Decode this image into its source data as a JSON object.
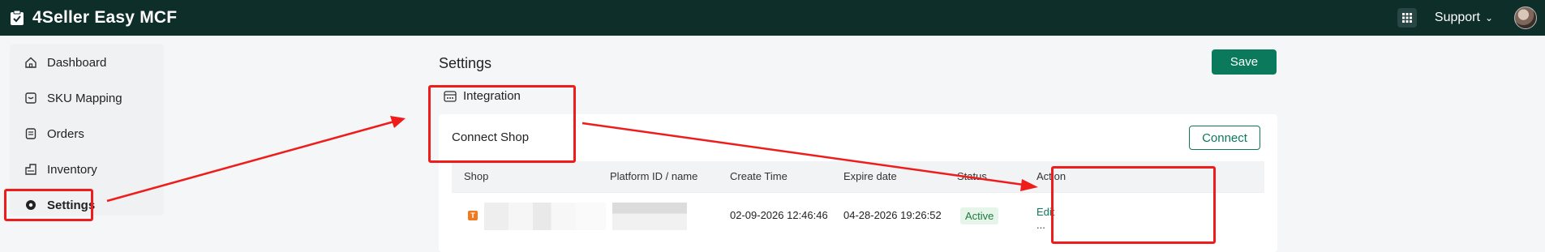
{
  "app": {
    "title": "4Seller Easy MCF",
    "logo_icon": "clipboard-icon"
  },
  "header": {
    "support_label": "Support",
    "apps_icon": "apps-grid-icon"
  },
  "sidebar": {
    "items": [
      {
        "label": "Dashboard",
        "icon": "home-icon"
      },
      {
        "label": "SKU Mapping",
        "icon": "sku-icon"
      },
      {
        "label": "Orders",
        "icon": "orders-icon"
      },
      {
        "label": "Inventory",
        "icon": "inventory-icon"
      },
      {
        "label": "Settings",
        "icon": "settings-icon",
        "active": true
      }
    ]
  },
  "page": {
    "title": "Settings",
    "save_label": "Save"
  },
  "integration": {
    "heading": "Integration",
    "connect_shop_label": "Connect Shop",
    "connect_button": "Connect",
    "table": {
      "columns": [
        "Shop",
        "Platform ID / name",
        "Create Time",
        "Expire date",
        "Status",
        "Action"
      ],
      "rows": [
        {
          "shop_icon_letter": "T",
          "create_time": "02-09-2026 12:46:46",
          "expire_date": "04-28-2026 19:26:52",
          "status": "Active",
          "action_edit": "Edit",
          "action_more": "..."
        }
      ]
    }
  },
  "colors": {
    "topbar": "#0e2e2a",
    "accent": "#0b7a5c",
    "annotation": "#ef1c1c"
  }
}
